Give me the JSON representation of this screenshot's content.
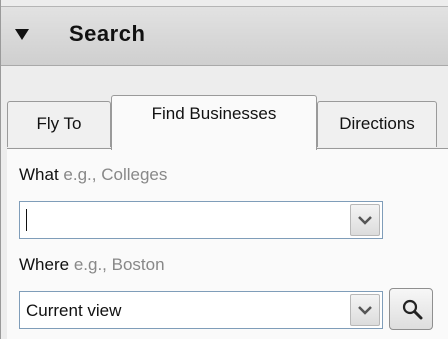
{
  "header": {
    "title": "Search",
    "icon": "collapse-arrow-icon"
  },
  "tabs": [
    {
      "label": "Fly To",
      "active": false
    },
    {
      "label": "Find Businesses",
      "active": true
    },
    {
      "label": "Directions",
      "active": false
    }
  ],
  "find_businesses": {
    "what_label": "What",
    "what_hint": "e.g., Colleges",
    "what_value": "",
    "where_label": "Where",
    "where_hint": "e.g., Boston",
    "where_value": "Current view",
    "search_icon": "magnifier-icon",
    "dropdown_icon": "chevron-down-icon"
  }
}
